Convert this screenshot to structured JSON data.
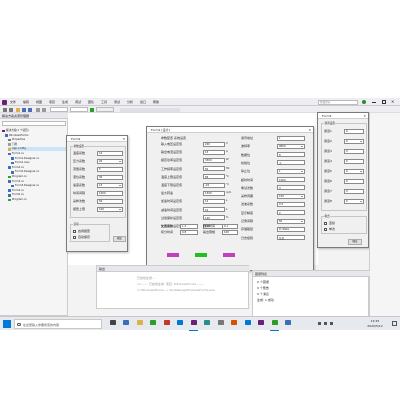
{
  "menubar": {
    "items": [
      "文件",
      "编辑",
      "视图",
      "项目",
      "生成",
      "调试",
      "团队",
      "工具",
      "测试",
      "分析",
      "窗口",
      "帮助"
    ],
    "search_placeholder": "快速启动"
  },
  "solution_explorer": {
    "title": "解决方案资源管理器",
    "items": [
      {
        "label": "解决方案(1 个项目)",
        "indent": 0
      },
      {
        "label": "WindowsForms",
        "indent": 1
      },
      {
        "label": "Properties",
        "indent": 2
      },
      {
        "label": "引用",
        "indent": 2
      },
      {
        "label": "App.config",
        "indent": 2
      },
      {
        "label": "Form1.cs",
        "indent": 2
      },
      {
        "label": "Form1.Designer.cs",
        "indent": 3
      },
      {
        "label": "Form1.resx",
        "indent": 3
      },
      {
        "label": "Form2.cs",
        "indent": 2
      },
      {
        "label": "Form2.Designer.cs",
        "indent": 3
      },
      {
        "label": "Program.cs",
        "indent": 2
      },
      {
        "label": "Form3.cs",
        "indent": 2
      },
      {
        "label": "Form3.Designer.cs",
        "indent": 3
      },
      {
        "label": "Form4.cs",
        "indent": 2
      },
      {
        "label": "Form5.cs",
        "indent": 2
      },
      {
        "label": "Program.cs",
        "indent": 2
      }
    ],
    "status": "解决方案资源管理器  团队资源管理器"
  },
  "left_dialog": {
    "title": "Form2",
    "group_label": "参数设置",
    "rows": [
      {
        "label": "温度系数",
        "value": "10"
      },
      {
        "label": "压力系数",
        "value": "20"
      },
      {
        "label": "流量系数",
        "value": "5"
      },
      {
        "label": "液位系数",
        "value": "30"
      },
      {
        "label": "速度系数",
        "value": "15"
      },
      {
        "label": "时间间隔",
        "value": "1000"
      },
      {
        "label": "采样次数",
        "value": "50"
      },
      {
        "label": "报警上限",
        "value": "100"
      }
    ],
    "bottom_group": "选项",
    "bottom_rows": [
      "启用报警",
      "自动保存"
    ],
    "ok_label": "确定"
  },
  "main_dialog": {
    "title": "Form1 [设计]",
    "header": "参数配置  系统设置",
    "left_rows": [
      {
        "label": "输入电压设定值",
        "value": "220",
        "unit": "V"
      },
      {
        "label": "输出电流设定值",
        "value": "15",
        "unit": "A"
      },
      {
        "label": "额定功率设定值",
        "value": "3300",
        "unit": "W"
      },
      {
        "label": "工作频率设定值",
        "value": "50",
        "unit": "Hz"
      },
      {
        "label": "温度上限设定值",
        "value": "85",
        "unit": "℃"
      },
      {
        "label": "温度下限设定值",
        "value": "-20",
        "unit": "℃"
      },
      {
        "label": "最大转速",
        "value": "1500",
        "unit": "rpm"
      },
      {
        "label": "加速时间设定值",
        "value": "10",
        "unit": "s"
      },
      {
        "label": "减速时间设定值",
        "value": "10",
        "unit": "s"
      },
      {
        "label": "过载保护设定值",
        "value": "120",
        "unit": "%"
      },
      {
        "label": "欠压保护设定值",
        "value": "180",
        "unit": "V"
      }
    ],
    "right_rows": [
      {
        "label": "通讯地址",
        "value": "1"
      },
      {
        "label": "波特率",
        "value": "9600"
      },
      {
        "label": "数据位",
        "value": "8"
      },
      {
        "label": "校验位",
        "value": "无"
      },
      {
        "label": "停止位",
        "value": "1"
      },
      {
        "label": "超时时间",
        "value": "1000"
      },
      {
        "label": "重试次数",
        "value": "3"
      },
      {
        "label": "采样周期",
        "value": "100"
      },
      {
        "label": "滤波系数",
        "value": "0.5"
      },
      {
        "label": "显示精度",
        "value": "2"
      },
      {
        "label": "记录间隔",
        "value": "60"
      },
      {
        "label": "存储路径",
        "value": "D:\\Data"
      },
      {
        "label": "日志级别",
        "value": "信息"
      }
    ],
    "bottom_left": [
      {
        "label": "比例系数",
        "value": "1.2"
      },
      {
        "label": "积分时间",
        "value": "0.8"
      }
    ],
    "bottom_mid": [
      {
        "label": "微分时间",
        "value": "0.1"
      },
      {
        "label": "输出限幅",
        "value": "100"
      }
    ],
    "color_buttons": [
      {
        "label": "",
        "color": "#c040c0"
      },
      {
        "label": "",
        "color": "#20c020"
      },
      {
        "label": "",
        "color": "#c040c0"
      }
    ]
  },
  "right_dialog": {
    "title": "Form3",
    "group_label": "通道设置",
    "rows": [
      {
        "label": "通道1",
        "value": "0"
      },
      {
        "label": "通道2",
        "value": "0"
      },
      {
        "label": "通道3",
        "value": "0"
      },
      {
        "label": "通道4",
        "value": "0"
      },
      {
        "label": "通道5",
        "value": "0"
      },
      {
        "label": "通道6",
        "value": "0"
      },
      {
        "label": "通道7",
        "value": "0"
      },
      {
        "label": "通道8",
        "value": "0"
      }
    ],
    "bottom_group": "模式",
    "bottom_rows": [
      "连续",
      "单次"
    ],
    "ok_label": "确定"
  },
  "output_panel": {
    "title": "输出",
    "lines": [
      "已启动生成...",
      "1>------ 已启动生成: 项目: WindowsForms ------",
      "1>WindowsForms -> bin\\Debug\\WindowsForms.exe"
    ]
  },
  "error_panel": {
    "title": "错误列表",
    "lines": [
      "0 个错误",
      "0 个警告",
      "0 个消息",
      "生成: 1 成功"
    ]
  },
  "taskbar": {
    "search_placeholder": "在这里输入你要搜索的内容",
    "time": "14:25",
    "date": "2020/5/12",
    "accent": "#0078d7"
  }
}
